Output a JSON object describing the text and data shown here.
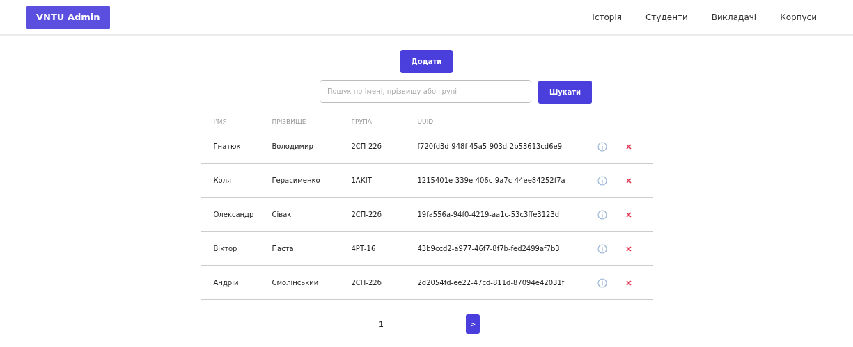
{
  "header": {
    "logo": "VNTU Admin",
    "nav": [
      "Історія",
      "Студенти",
      "Викладачі",
      "Корпуси"
    ]
  },
  "add_button": "Додати",
  "search": {
    "placeholder": "Пошук по імені, прізвищу або групі",
    "button": "Шукати"
  },
  "table": {
    "columns": [
      "І'МЯ",
      "ПРІЗВИЩЕ",
      "ГРУПА",
      "UUID"
    ],
    "rows": [
      {
        "name": "Гнатюк",
        "surname": "Володимир",
        "group": "2СП-22б",
        "uuid": "f720fd3d-948f-45a5-903d-2b53613cd6e9"
      },
      {
        "name": "Коля",
        "surname": "Герасименко",
        "group": "1АКІТ",
        "uuid": "1215401e-339e-406c-9a7c-44ee84252f7a"
      },
      {
        "name": "Олександр",
        "surname": "Сівак",
        "group": "2СП-22б",
        "uuid": "19fa556a-94f0-4219-aa1c-53c3ffe3123d"
      },
      {
        "name": "Віктор",
        "surname": "Паста",
        "group": "4РТ-16",
        "uuid": "43b9ccd2-a977-46f7-8f7b-fed2499af7b3"
      },
      {
        "name": "Андрій",
        "surname": "Смолінський",
        "group": "2СП-22б",
        "uuid": "2d2054fd-ee22-47cd-811d-87094e42031f"
      }
    ]
  },
  "pagination": {
    "page": "1",
    "next": ">"
  }
}
